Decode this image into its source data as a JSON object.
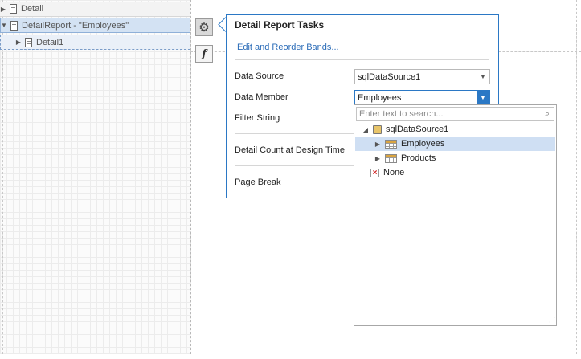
{
  "bands": [
    {
      "label": "Detail",
      "icon": "band-icon"
    },
    {
      "label": "DetailReport - \"Employees\"",
      "icon": "band-icon"
    },
    {
      "label": "Detail1",
      "icon": "band-icon"
    }
  ],
  "smart_tags": {
    "tasks_icon": "gear-icon",
    "expression_icon": "function-icon",
    "expression_label": "f"
  },
  "panel": {
    "title": "Detail Report Tasks",
    "link": "Edit and Reorder Bands...",
    "data_source_label": "Data Source",
    "data_source_value": "sqlDataSource1",
    "data_member_label": "Data Member",
    "data_member_value": "Employees",
    "filter_string_label": "Filter String",
    "detail_count_label": "Detail Count at Design Time",
    "page_break_label": "Page Break"
  },
  "dropdown": {
    "search_placeholder": "Enter text to search...",
    "tree": [
      {
        "label": "sqlDataSource1",
        "icon": "database-icon",
        "expanded": true
      },
      {
        "label": "Employees",
        "icon": "table-icon",
        "selected": true
      },
      {
        "label": "Products",
        "icon": "table-icon"
      },
      {
        "label": "None",
        "icon": "none-icon"
      }
    ]
  },
  "colors": {
    "accent": "#2b78c5",
    "selection": "#cfdff3"
  }
}
